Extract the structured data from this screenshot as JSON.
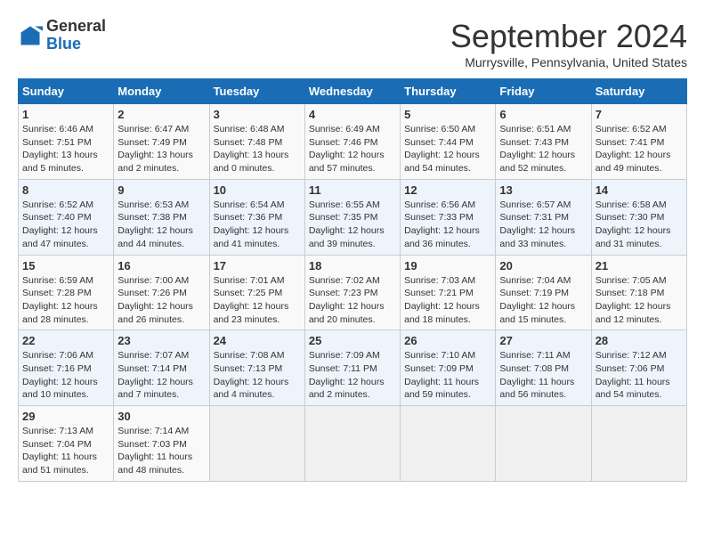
{
  "header": {
    "logo_general": "General",
    "logo_blue": "Blue",
    "month_title": "September 2024",
    "location": "Murrysville, Pennsylvania, United States"
  },
  "calendar": {
    "days_of_week": [
      "Sunday",
      "Monday",
      "Tuesday",
      "Wednesday",
      "Thursday",
      "Friday",
      "Saturday"
    ],
    "weeks": [
      [
        {
          "day": "1",
          "info": "Sunrise: 6:46 AM\nSunset: 7:51 PM\nDaylight: 13 hours\nand 5 minutes."
        },
        {
          "day": "2",
          "info": "Sunrise: 6:47 AM\nSunset: 7:49 PM\nDaylight: 13 hours\nand 2 minutes."
        },
        {
          "day": "3",
          "info": "Sunrise: 6:48 AM\nSunset: 7:48 PM\nDaylight: 13 hours\nand 0 minutes."
        },
        {
          "day": "4",
          "info": "Sunrise: 6:49 AM\nSunset: 7:46 PM\nDaylight: 12 hours\nand 57 minutes."
        },
        {
          "day": "5",
          "info": "Sunrise: 6:50 AM\nSunset: 7:44 PM\nDaylight: 12 hours\nand 54 minutes."
        },
        {
          "day": "6",
          "info": "Sunrise: 6:51 AM\nSunset: 7:43 PM\nDaylight: 12 hours\nand 52 minutes."
        },
        {
          "day": "7",
          "info": "Sunrise: 6:52 AM\nSunset: 7:41 PM\nDaylight: 12 hours\nand 49 minutes."
        }
      ],
      [
        {
          "day": "8",
          "info": "Sunrise: 6:52 AM\nSunset: 7:40 PM\nDaylight: 12 hours\nand 47 minutes."
        },
        {
          "day": "9",
          "info": "Sunrise: 6:53 AM\nSunset: 7:38 PM\nDaylight: 12 hours\nand 44 minutes."
        },
        {
          "day": "10",
          "info": "Sunrise: 6:54 AM\nSunset: 7:36 PM\nDaylight: 12 hours\nand 41 minutes."
        },
        {
          "day": "11",
          "info": "Sunrise: 6:55 AM\nSunset: 7:35 PM\nDaylight: 12 hours\nand 39 minutes."
        },
        {
          "day": "12",
          "info": "Sunrise: 6:56 AM\nSunset: 7:33 PM\nDaylight: 12 hours\nand 36 minutes."
        },
        {
          "day": "13",
          "info": "Sunrise: 6:57 AM\nSunset: 7:31 PM\nDaylight: 12 hours\nand 33 minutes."
        },
        {
          "day": "14",
          "info": "Sunrise: 6:58 AM\nSunset: 7:30 PM\nDaylight: 12 hours\nand 31 minutes."
        }
      ],
      [
        {
          "day": "15",
          "info": "Sunrise: 6:59 AM\nSunset: 7:28 PM\nDaylight: 12 hours\nand 28 minutes."
        },
        {
          "day": "16",
          "info": "Sunrise: 7:00 AM\nSunset: 7:26 PM\nDaylight: 12 hours\nand 26 minutes."
        },
        {
          "day": "17",
          "info": "Sunrise: 7:01 AM\nSunset: 7:25 PM\nDaylight: 12 hours\nand 23 minutes."
        },
        {
          "day": "18",
          "info": "Sunrise: 7:02 AM\nSunset: 7:23 PM\nDaylight: 12 hours\nand 20 minutes."
        },
        {
          "day": "19",
          "info": "Sunrise: 7:03 AM\nSunset: 7:21 PM\nDaylight: 12 hours\nand 18 minutes."
        },
        {
          "day": "20",
          "info": "Sunrise: 7:04 AM\nSunset: 7:19 PM\nDaylight: 12 hours\nand 15 minutes."
        },
        {
          "day": "21",
          "info": "Sunrise: 7:05 AM\nSunset: 7:18 PM\nDaylight: 12 hours\nand 12 minutes."
        }
      ],
      [
        {
          "day": "22",
          "info": "Sunrise: 7:06 AM\nSunset: 7:16 PM\nDaylight: 12 hours\nand 10 minutes."
        },
        {
          "day": "23",
          "info": "Sunrise: 7:07 AM\nSunset: 7:14 PM\nDaylight: 12 hours\nand 7 minutes."
        },
        {
          "day": "24",
          "info": "Sunrise: 7:08 AM\nSunset: 7:13 PM\nDaylight: 12 hours\nand 4 minutes."
        },
        {
          "day": "25",
          "info": "Sunrise: 7:09 AM\nSunset: 7:11 PM\nDaylight: 12 hours\nand 2 minutes."
        },
        {
          "day": "26",
          "info": "Sunrise: 7:10 AM\nSunset: 7:09 PM\nDaylight: 11 hours\nand 59 minutes."
        },
        {
          "day": "27",
          "info": "Sunrise: 7:11 AM\nSunset: 7:08 PM\nDaylight: 11 hours\nand 56 minutes."
        },
        {
          "day": "28",
          "info": "Sunrise: 7:12 AM\nSunset: 7:06 PM\nDaylight: 11 hours\nand 54 minutes."
        }
      ],
      [
        {
          "day": "29",
          "info": "Sunrise: 7:13 AM\nSunset: 7:04 PM\nDaylight: 11 hours\nand 51 minutes."
        },
        {
          "day": "30",
          "info": "Sunrise: 7:14 AM\nSunset: 7:03 PM\nDaylight: 11 hours\nand 48 minutes."
        },
        {
          "day": "",
          "info": ""
        },
        {
          "day": "",
          "info": ""
        },
        {
          "day": "",
          "info": ""
        },
        {
          "day": "",
          "info": ""
        },
        {
          "day": "",
          "info": ""
        }
      ]
    ]
  }
}
